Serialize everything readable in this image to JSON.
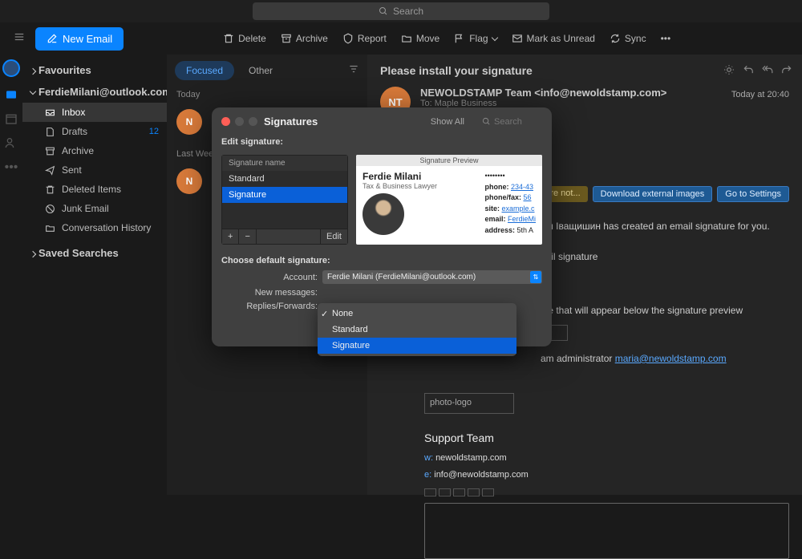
{
  "topbar": {
    "search_placeholder": "Search"
  },
  "toolbar": {
    "new_email": "New Email",
    "delete": "Delete",
    "archive": "Archive",
    "report": "Report",
    "move": "Move",
    "flag": "Flag",
    "unread": "Mark as Unread",
    "sync": "Sync"
  },
  "sidebar": {
    "favourites": "Favourites",
    "account": "FerdieMilani@outlook.com",
    "items": [
      {
        "label": "Inbox",
        "count": ""
      },
      {
        "label": "Drafts",
        "count": "12"
      },
      {
        "label": "Archive",
        "count": ""
      },
      {
        "label": "Sent",
        "count": ""
      },
      {
        "label": "Deleted Items",
        "count": ""
      },
      {
        "label": "Junk Email",
        "count": ""
      },
      {
        "label": "Conversation History",
        "count": ""
      }
    ],
    "saved": "Saved Searches"
  },
  "msglist": {
    "focused": "Focused",
    "other": "Other",
    "today": "Today",
    "lastweek": "Last Week",
    "avatar1": "N",
    "avatar2": "N"
  },
  "reading": {
    "title": "Please install your signature",
    "avatar": "NT",
    "from": "NEWOLDSTAMP Team <info@newoldstamp.com>",
    "to_label": "To:",
    "to_name": "Maple Business",
    "time": "Today at 20:40",
    "pill_warn": "this message were not...",
    "pill_dl": "Download external images",
    "pill_settings": "Go to Settings",
    "body_line1_a": "рія Іващишин has created an email signature for you.",
    "body_line2": "nail signature",
    "body_line3": "ide that will appear below the signature preview",
    "body_line4_a": "am administrator ",
    "body_line4_link": "maria@newoldstamp.com",
    "photo": "photo-logo",
    "support_title": "Support Team",
    "support_w_label": "w:",
    "support_w": "newoldstamp.com",
    "support_e_label": "e:",
    "support_e": "info@newoldstamp.com"
  },
  "modal": {
    "title": "Signatures",
    "show_all": "Show All",
    "search_placeholder": "Search",
    "edit_label": "Edit signature:",
    "sig_header": "Signature name",
    "sigs": [
      "Standard",
      "Signature"
    ],
    "edit_btn": "Edit",
    "preview_header": "Signature Preview",
    "preview_name": "Ferdie Milani",
    "preview_title": "Tax & Business Lawyer",
    "pv_phone_l": "phone:",
    "pv_phone": "234-43",
    "pv_fax_l": "phone/fax:",
    "pv_fax": "56",
    "pv_site_l": "site:",
    "pv_site": "example.c",
    "pv_email_l": "email:",
    "pv_email": "FerdieMi",
    "pv_addr_l": "address:",
    "pv_addr": "5th A",
    "choose_label": "Choose default signature:",
    "account_label": "Account:",
    "account_value": "Ferdie Milani (FerdieMilani@outlook.com)",
    "newmsg_label": "New messages:",
    "reply_label": "Replies/Forwards:"
  },
  "dropdown": {
    "options": [
      "None",
      "Standard",
      "Signature"
    ]
  }
}
